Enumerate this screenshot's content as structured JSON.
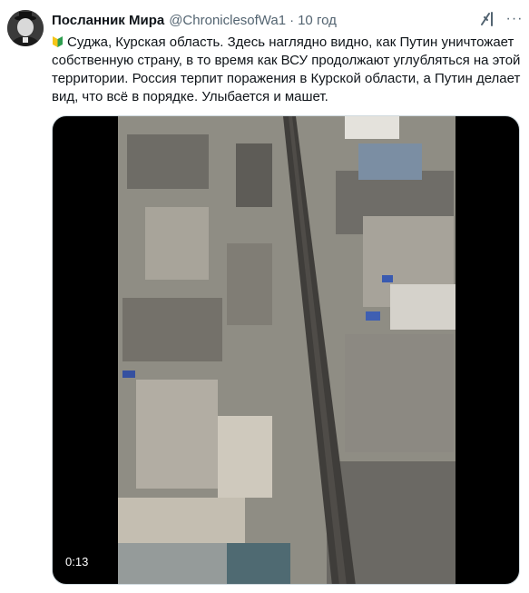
{
  "author": {
    "display_name": "Посланник Мира",
    "handle": "@ChroniclesofWa1",
    "separator": "·",
    "timestamp": "10 год",
    "avatar_icon": "avatar-portrait"
  },
  "actions": {
    "grok_icon": "grok-icon",
    "more_icon": "more-horizontal-icon",
    "more_label": "···"
  },
  "tweet": {
    "lines": [
      "Суджа, Курская область. Здесь наглядно видно, как Путин уничтожает",
      "собственную страну, в то время как ВСУ продолжают углубляться на этой",
      "территории. Россия терпит поражения в Курской области, а Путин делает",
      "вид, что всё в порядке. Улыбается и машет."
    ],
    "leading_icon": "japanese-beginner-badge-icon"
  },
  "media": {
    "type": "video",
    "duration": "0:13"
  },
  "colors": {
    "text": "#0f1419",
    "secondary": "#536471",
    "border": "#cfd9de"
  }
}
